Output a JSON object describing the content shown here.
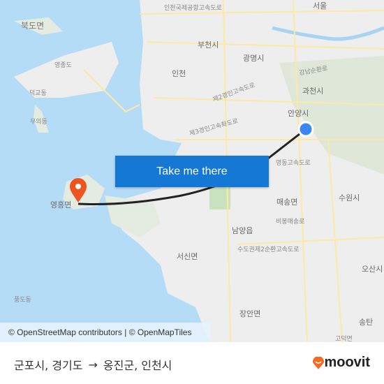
{
  "map": {
    "labels": [
      "서울",
      "인천국제공항고속도로",
      "북도면",
      "부천시",
      "광명시",
      "영종도",
      "인천",
      "강남순환로",
      "과천시",
      "덕교동",
      "제2경인고속도로",
      "안양시",
      "무의동",
      "제3경인고속화도로",
      "영동고속도로",
      "영흥면",
      "매송면",
      "수원시",
      "남양읍",
      "비봉매송로",
      "수도권제2순환고속도로",
      "서신면",
      "오산시",
      "풍도동",
      "장안면",
      "송탄",
      "고덕면",
      "수도권제2순환고속도로"
    ],
    "origin_color": "#3b86f5",
    "destination_color": "#f0541e",
    "sea_color": "#b5dcf7",
    "land_color": "#eeeeee"
  },
  "cta": {
    "label": "Take me there"
  },
  "attribution": "© OpenStreetMap contributors | © OpenMapTiles",
  "footer": {
    "from": "군포시, 경기도",
    "arrow": "→",
    "to": "옹진군, 인천시",
    "logo": "moovit",
    "brand_color": "#f26b21"
  }
}
